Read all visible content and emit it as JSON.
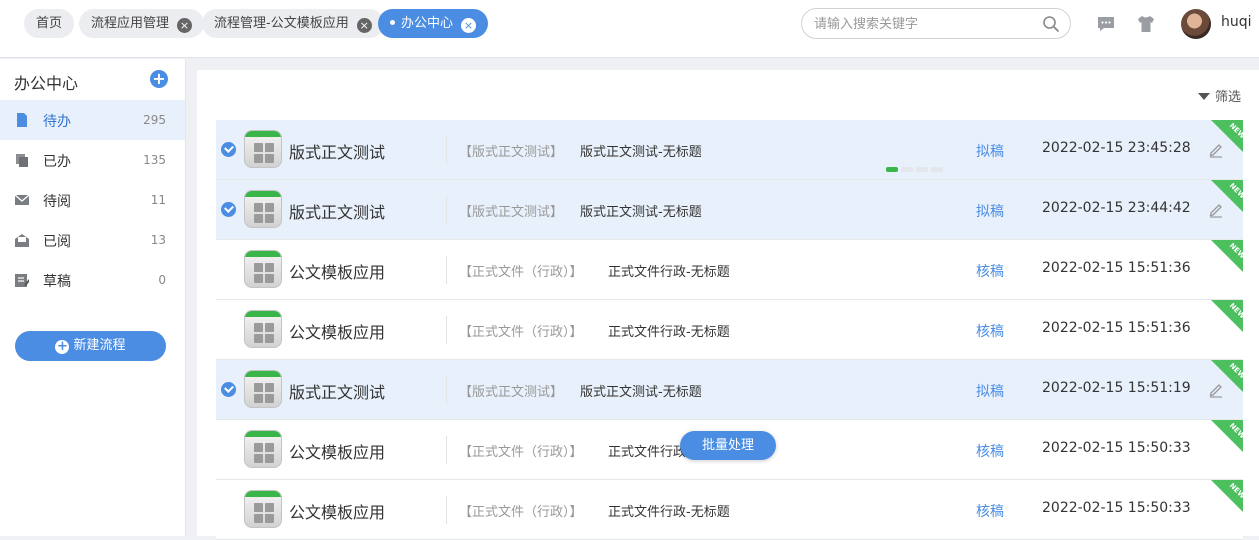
{
  "tabs": [
    {
      "label": "首页",
      "closable": false
    },
    {
      "label": "流程应用管理",
      "closable": true
    },
    {
      "label": "流程管理-公文模板应用",
      "closable": true
    },
    {
      "label": "办公中心",
      "closable": true,
      "active": true
    }
  ],
  "search": {
    "placeholder": "请输入搜索关键字"
  },
  "user": {
    "name": "huqi"
  },
  "sidebar": {
    "title": "办公中心",
    "items": [
      {
        "label": "待办",
        "count": "295",
        "icon": "document-icon"
      },
      {
        "label": "已办",
        "count": "135",
        "icon": "stack-icon"
      },
      {
        "label": "待阅",
        "count": "11",
        "icon": "mail-icon"
      },
      {
        "label": "已阅",
        "count": "13",
        "icon": "open-mail-icon"
      },
      {
        "label": "草稿",
        "count": "0",
        "icon": "draft-icon"
      }
    ],
    "new_flow_label": "新建流程"
  },
  "main": {
    "filter_label": "筛选",
    "batch_label": "批量处理",
    "rows": [
      {
        "name": "版式正文测试",
        "category": "【版式正文测试】",
        "title": "版式正文测试-无标题",
        "status": "拟稿",
        "time": "2022-02-15 23:45:28",
        "selected": true,
        "editable": true
      },
      {
        "name": "版式正文测试",
        "category": "【版式正文测试】",
        "title": "版式正文测试-无标题",
        "status": "拟稿",
        "time": "2022-02-15 23:44:42",
        "selected": true,
        "editable": true
      },
      {
        "name": "公文模板应用",
        "category": "【正式文件（行政）】",
        "title": "正式文件行政-无标题",
        "status": "核稿",
        "time": "2022-02-15 15:51:36",
        "selected": false,
        "editable": false
      },
      {
        "name": "公文模板应用",
        "category": "【正式文件（行政）】",
        "title": "正式文件行政-无标题",
        "status": "核稿",
        "time": "2022-02-15 15:51:36",
        "selected": false,
        "editable": false
      },
      {
        "name": "版式正文测试",
        "category": "【版式正文测试】",
        "title": "版式正文测试-无标题",
        "status": "拟稿",
        "time": "2022-02-15 15:51:19",
        "selected": true,
        "editable": true
      },
      {
        "name": "公文模板应用",
        "category": "【正式文件（行政）】",
        "title": "正式文件行政-无标题",
        "status": "核稿",
        "time": "2022-02-15 15:50:33",
        "selected": false,
        "editable": false
      },
      {
        "name": "公文模板应用",
        "category": "【正式文件（行政）】",
        "title": "正式文件行政-无标题",
        "status": "核稿",
        "time": "2022-02-15 15:50:33",
        "selected": false,
        "editable": false
      }
    ],
    "new_tag": "NEW"
  },
  "colors": {
    "accent": "#4a8de3",
    "selected_row": "#e8f0fb",
    "new_tag": "#4cbf5e"
  }
}
